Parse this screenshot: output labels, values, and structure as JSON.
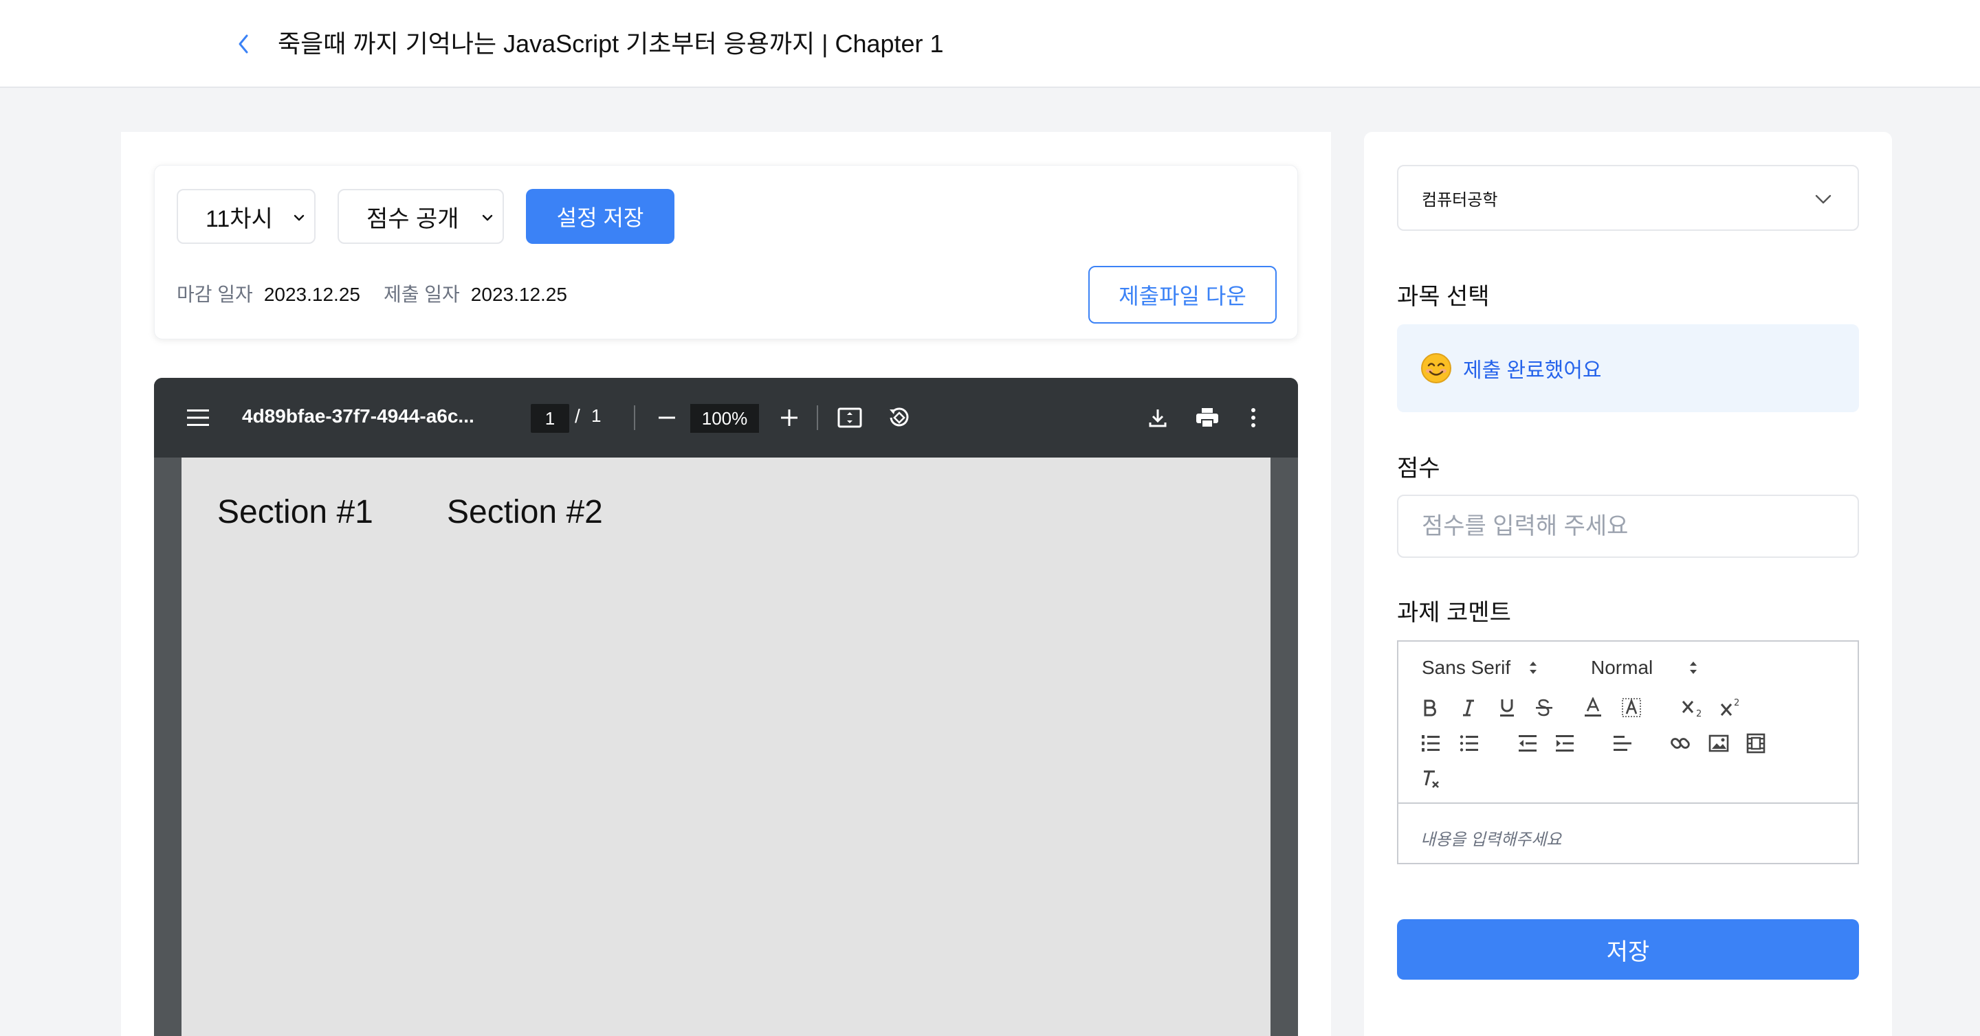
{
  "header": {
    "title": "죽을때 까지 기억나는 JavaScript 기초부터 응용까지 | Chapter 1",
    "back_icon": "chevron-left-icon"
  },
  "settings": {
    "session_select": "11차시",
    "score_visibility_select": "점수 공개",
    "save_settings_label": "설정 저장",
    "deadline_label": "마감 일자",
    "deadline_value": "2023.12.25",
    "submit_label": "제출 일자",
    "submit_value": "2023.12.25",
    "download_label": "제출파일 다운"
  },
  "pdf_viewer": {
    "file_name": "4d89bfae-37f7-4944-a6c...",
    "page_current": "1",
    "page_separator": "/",
    "page_total": "1",
    "zoom": "100%",
    "content": {
      "section1": "Section #1",
      "section2": "Section #2"
    }
  },
  "right": {
    "department_select": "컴퓨터공학",
    "subject_label": "과목 선택",
    "status_text": "제출 완료했어요",
    "score_label": "점수",
    "score_placeholder": "점수를 입력해 주세요",
    "comment_label": "과제 코멘트",
    "editor": {
      "font_family": "Sans Serif",
      "font_size": "Normal",
      "placeholder": "내용을 입력해주세요"
    },
    "save_label": "저장"
  },
  "colors": {
    "accent": "#3b82f6",
    "status_bg": "#eef5fd",
    "pdf_toolbar": "#323639"
  }
}
